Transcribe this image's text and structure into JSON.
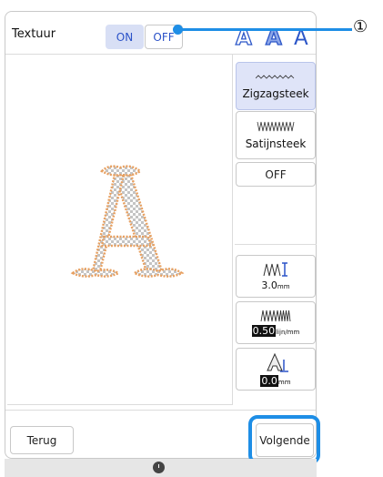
{
  "texture": {
    "label": "Textuur",
    "on_label": "ON",
    "off_label": "OFF",
    "selected": "ON"
  },
  "font_icons": [
    "A",
    "A",
    "A"
  ],
  "preview_letter": "A",
  "stitch_options": {
    "zigzag_label": "Zigzagsteek",
    "satin_label": "Satijnsteek",
    "off_label": "OFF",
    "selected": "Zigzagsteek"
  },
  "settings": {
    "width_value": "3.0",
    "width_unit": "mm",
    "density_value": "0.50",
    "density_unit": "lijn/mm",
    "offset_value": "0.0",
    "offset_unit": "mm"
  },
  "footer": {
    "back_label": "Terug",
    "next_label": "Volgende"
  },
  "callout": {
    "number": "①"
  },
  "colors": {
    "accent": "#1e8ee6",
    "selected_bg": "#dfe4f8",
    "text_blue": "#2b52c8",
    "outline_orange": "#e8a060"
  }
}
